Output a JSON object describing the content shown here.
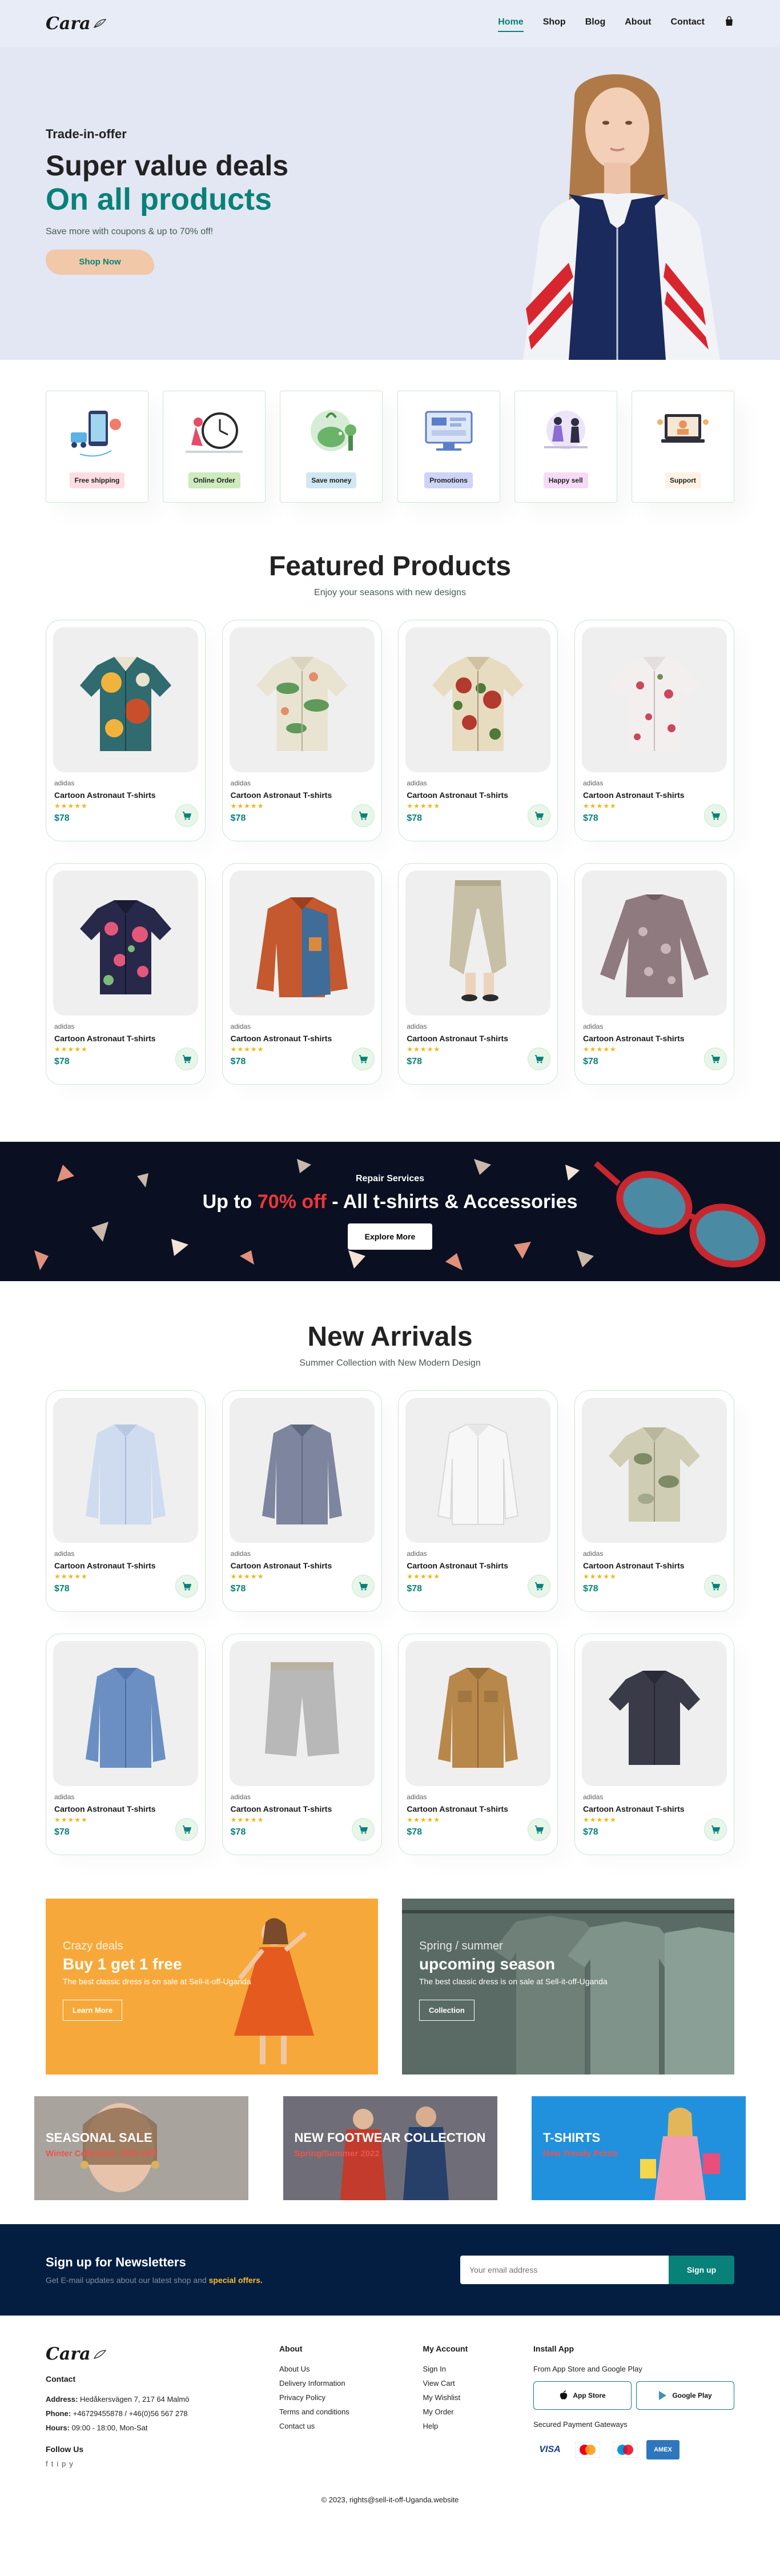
{
  "header": {
    "logo_text": "Cara",
    "nav": [
      "Home",
      "Shop",
      "Blog",
      "About",
      "Contact"
    ],
    "cart_icon": "bag-icon"
  },
  "hero": {
    "kicker": "Trade-in-offer",
    "title_line1": "Super value deals",
    "title_line2": "On all products",
    "text": "Save more with coupons & up to 70% off!",
    "button": "Shop Now"
  },
  "features": [
    {
      "label": "Free shipping",
      "bg": "#fddde4"
    },
    {
      "label": "Online Order",
      "bg": "#cdebbc"
    },
    {
      "label": "Save money",
      "bg": "#d1e8f2"
    },
    {
      "label": "Promotions",
      "bg": "#cdd4f8"
    },
    {
      "label": "Happy sell",
      "bg": "#f6dbf6"
    },
    {
      "label": "Support",
      "bg": "#fff2e5"
    }
  ],
  "featured": {
    "title": "Featured Products",
    "subtitle": "Enjoy your seasons with new designs",
    "products": [
      {
        "brand": "adidas",
        "name": "Cartoon Astronaut T-shirts",
        "stars": "★★★★★",
        "price": "$78"
      },
      {
        "brand": "adidas",
        "name": "Cartoon Astronaut T-shirts",
        "stars": "★★★★★",
        "price": "$78"
      },
      {
        "brand": "adidas",
        "name": "Cartoon Astronaut T-shirts",
        "stars": "★★★★★",
        "price": "$78"
      },
      {
        "brand": "adidas",
        "name": "Cartoon Astronaut T-shirts",
        "stars": "★★★★★",
        "price": "$78"
      },
      {
        "brand": "adidas",
        "name": "Cartoon Astronaut T-shirts",
        "stars": "★★★★★",
        "price": "$78"
      },
      {
        "brand": "adidas",
        "name": "Cartoon Astronaut T-shirts",
        "stars": "★★★★★",
        "price": "$78"
      },
      {
        "brand": "adidas",
        "name": "Cartoon Astronaut T-shirts",
        "stars": "★★★★★",
        "price": "$78"
      },
      {
        "brand": "adidas",
        "name": "Cartoon Astronaut T-shirts",
        "stars": "★★★★★",
        "price": "$78"
      }
    ]
  },
  "banner": {
    "kicker": "Repair Services",
    "title_pre": "Up to ",
    "title_accent": "70% off",
    "title_post": " - All t-shirts & Accessories",
    "button": "Explore More"
  },
  "arrivals": {
    "title": "New Arrivals",
    "subtitle": "Summer Collection with New Modern Design",
    "products": [
      {
        "brand": "adidas",
        "name": "Cartoon Astronaut T-shirts",
        "stars": "★★★★★",
        "price": "$78"
      },
      {
        "brand": "adidas",
        "name": "Cartoon Astronaut T-shirts",
        "stars": "★★★★★",
        "price": "$78"
      },
      {
        "brand": "adidas",
        "name": "Cartoon Astronaut T-shirts",
        "stars": "★★★★★",
        "price": "$78"
      },
      {
        "brand": "adidas",
        "name": "Cartoon Astronaut T-shirts",
        "stars": "★★★★★",
        "price": "$78"
      },
      {
        "brand": "adidas",
        "name": "Cartoon Astronaut T-shirts",
        "stars": "★★★★★",
        "price": "$78"
      },
      {
        "brand": "adidas",
        "name": "Cartoon Astronaut T-shirts",
        "stars": "★★★★★",
        "price": "$78"
      },
      {
        "brand": "adidas",
        "name": "Cartoon Astronaut T-shirts",
        "stars": "★★★★★",
        "price": "$78"
      },
      {
        "brand": "adidas",
        "name": "Cartoon Astronaut T-shirts",
        "stars": "★★★★★",
        "price": "$78"
      }
    ]
  },
  "sm_banners": [
    {
      "kicker": "Crazy deals",
      "title": "Buy 1 get 1 free",
      "text": "The best classic dress is on sale at Sell-it-off-Uganda",
      "button": "Learn More"
    },
    {
      "kicker": "Spring / summer",
      "title": "upcoming season",
      "text": "The best classic dress is on sale at Sell-it-off-Uganda",
      "button": "Collection"
    }
  ],
  "banner3": [
    {
      "title": "SEASONAL SALE",
      "subtitle": "Winter Collection -50% OFF"
    },
    {
      "title": "NEW FOOTWEAR COLLECTION",
      "subtitle": "Spring/Summer 2022"
    },
    {
      "title": "T-SHIRTS",
      "subtitle": "New Trendy Prints"
    }
  ],
  "newsletter": {
    "title": "Sign up for Newsletters",
    "text_pre": "Get E-mail updates about our latest shop and ",
    "text_highlight": "special offers.",
    "placeholder": "Your email address",
    "button": "Sign up"
  },
  "footer": {
    "logo_text": "Cara",
    "contact_title": "Contact",
    "address_label": "Address:",
    "address": "Hedåkersvägen 7, 217 64 Malmö",
    "phone_label": "Phone:",
    "phone": "+46729455878 / +46(0)56 567 278",
    "hours_label": "Hours:",
    "hours": "09:00 - 18:00, Mon-Sat",
    "follow_title": "Follow Us",
    "socials": [
      "f",
      "t",
      "i",
      "p",
      "y"
    ],
    "about_title": "About",
    "about_links": [
      "About Us",
      "Delivery Information",
      "Privacy Policy",
      "Terms and conditions",
      "Contact us"
    ],
    "account_title": "My Account",
    "account_links": [
      "Sign In",
      "View Cart",
      "My Wishlist",
      "My Order",
      "Help"
    ],
    "install_title": "Install App",
    "install_text": "From App Store and Google Play",
    "app_store": "App Store",
    "google_play": "Google Play",
    "payment_text": "Secured Payment Gateways",
    "payments": [
      "VISA",
      "MC",
      "Maestro",
      "AMEX"
    ],
    "copyright": "© 2023, rights@sell-it-off-Uganda.website"
  }
}
